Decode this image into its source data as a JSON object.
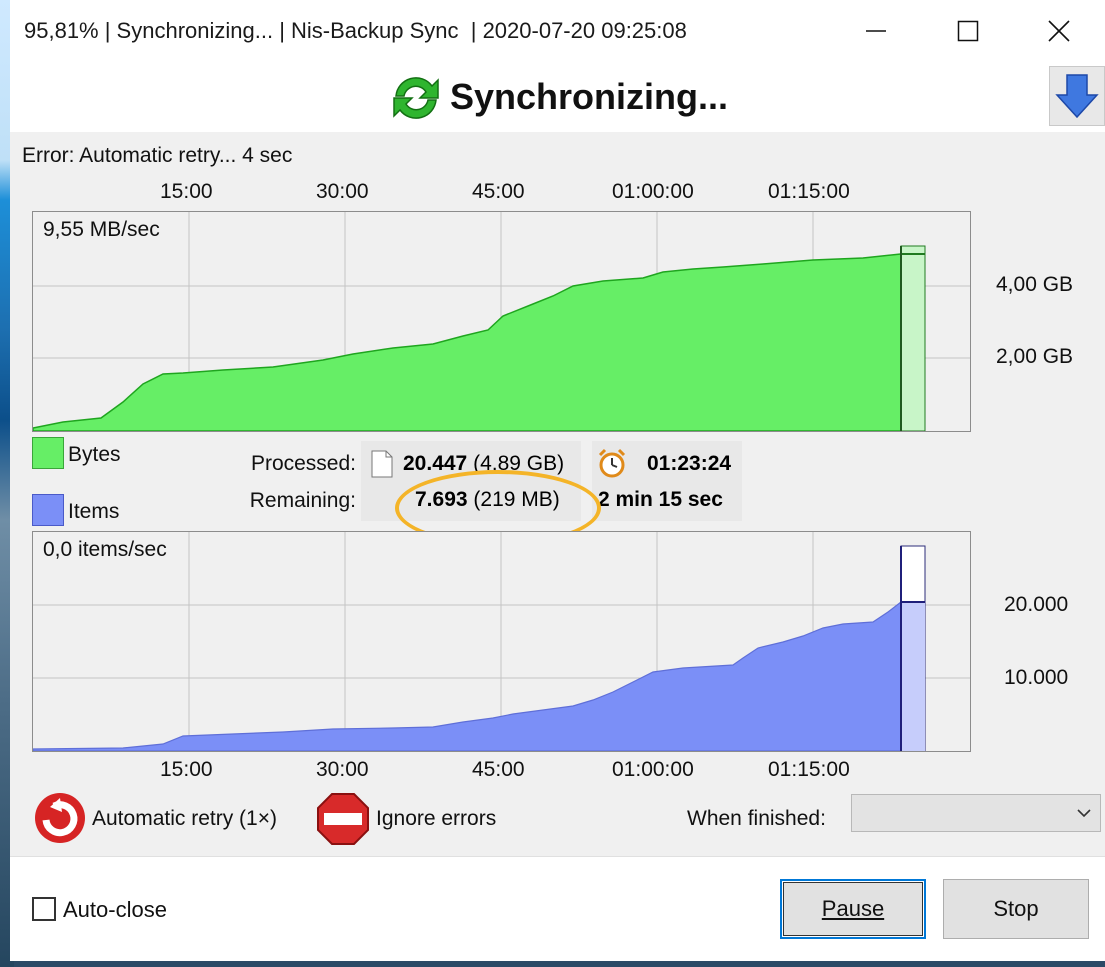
{
  "window": {
    "title": "95,81% | Synchronizing... | Nis-Backup Sync  | 2020-07-20 09:25:08"
  },
  "header": {
    "title": "Synchronizing..."
  },
  "status": {
    "error": "Error: Automatic retry... 4 sec"
  },
  "time_axis": [
    "15:00",
    "30:00",
    "45:00",
    "01:00:00",
    "01:15:00"
  ],
  "bytes_chart": {
    "rate": "9,55 MB/sec",
    "y_labels": [
      "4,00 GB",
      "2,00 GB"
    ],
    "fill_color": "#66ee66",
    "line_color": "#1fa51f",
    "remaining_color": "#c8f5c8"
  },
  "items_chart": {
    "rate": "0,0 items/sec",
    "y_labels": [
      "20.000",
      "10.000"
    ],
    "fill_color": "#7b8ff7",
    "line_color": "#2d2da8",
    "remaining_color": "#c6cdfb"
  },
  "legend": {
    "bytes": "Bytes",
    "items": "Items"
  },
  "stats": {
    "processed_label": "Processed:",
    "remaining_label": "Remaining:",
    "processed_count": "20.447",
    "processed_size": "(4,89 GB)",
    "remaining_count": "7.693",
    "remaining_size": "(219 MB)",
    "elapsed": "01:23:24",
    "remaining_time": "2 min 15 sec"
  },
  "options": {
    "retry_label": "Automatic retry (1×)",
    "ignore_label": "Ignore errors",
    "when_finished_label": "When finished:",
    "when_finished_value": ""
  },
  "footer": {
    "autoclose_label": "Auto-close",
    "pause_label": "Pause",
    "stop_label": "Stop"
  }
}
